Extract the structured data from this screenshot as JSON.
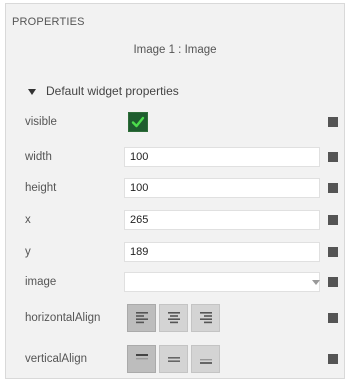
{
  "panel": {
    "title": "PROPERTIES",
    "subtitle": "Image 1 : Image",
    "section_label": "Default widget properties"
  },
  "properties": {
    "visible": {
      "label": "visible",
      "checked": true
    },
    "width": {
      "label": "width",
      "value": "100"
    },
    "height": {
      "label": "height",
      "value": "100"
    },
    "x": {
      "label": "x",
      "value": "265"
    },
    "y": {
      "label": "y",
      "value": "189"
    },
    "image": {
      "label": "image",
      "value": ""
    },
    "horizontalAlign": {
      "label": "horizontalAlign",
      "options": [
        "align-left-icon",
        "align-center-icon",
        "align-right-icon"
      ],
      "selected": "align-left-icon"
    },
    "verticalAlign": {
      "label": "verticalAlign",
      "options": [
        "align-top-icon",
        "align-middle-icon",
        "align-bottom-icon"
      ],
      "selected": "align-top-icon"
    }
  },
  "colors": {
    "panel_background": "#f2f2f2",
    "checkbox_background": "#1e5c2e",
    "checkmark": "#4cdc4c",
    "reset_square": "#555555",
    "button_background": "#d4d4d4"
  }
}
